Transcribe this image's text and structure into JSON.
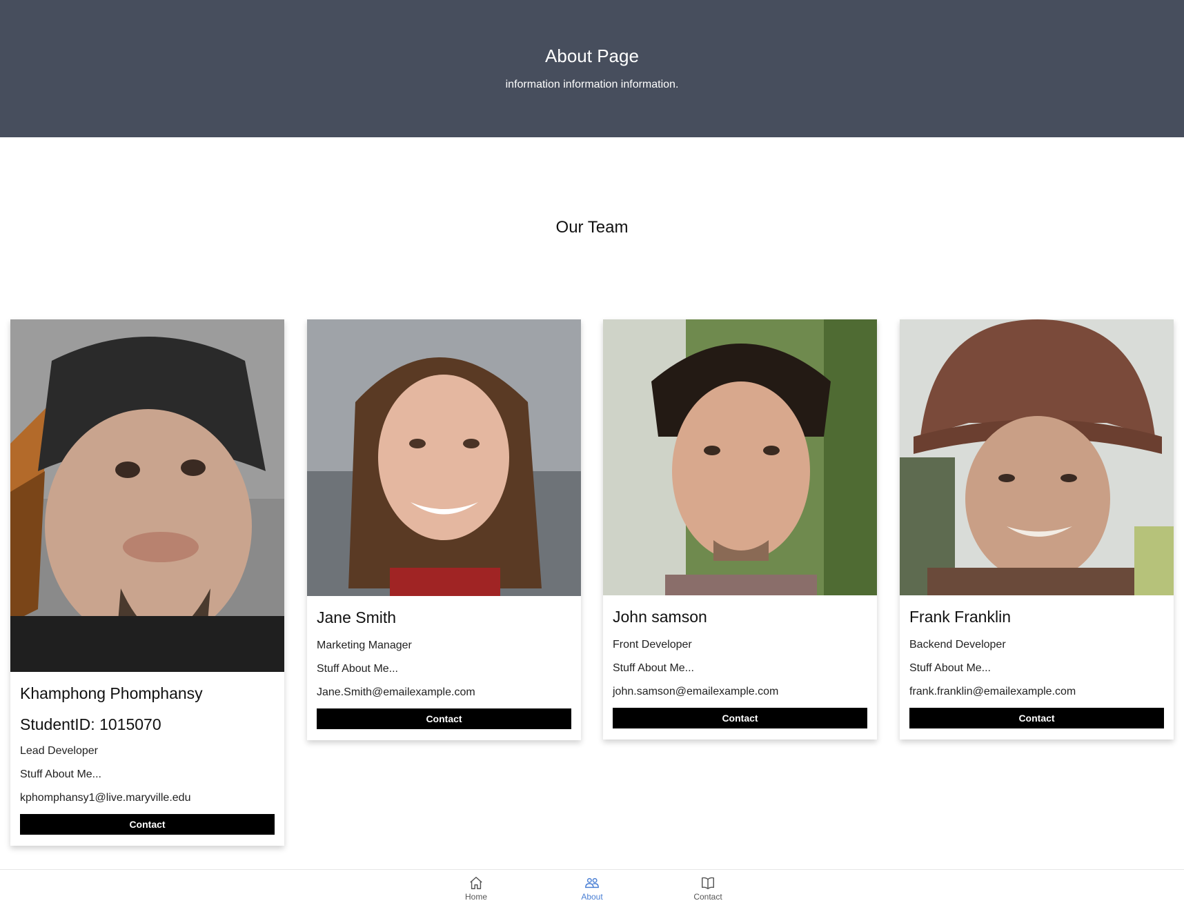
{
  "hero": {
    "title": "About Page",
    "subtitle": "information information information."
  },
  "team": {
    "heading": "Our Team",
    "members": [
      {
        "name": "Khamphong Phomphansy",
        "student_id": "StudentID: 1015070",
        "role": "Lead Developer",
        "about": "Stuff About Me...",
        "email": "kphomphansy1@live.maryville.edu",
        "button": "Contact"
      },
      {
        "name": "Jane Smith",
        "role": "Marketing Manager",
        "about": "Stuff About Me...",
        "email": "Jane.Smith@emailexample.com",
        "button": "Contact"
      },
      {
        "name": "John samson",
        "role": "Front Developer",
        "about": "Stuff About Me...",
        "email": "john.samson@emailexample.com",
        "button": "Contact"
      },
      {
        "name": "Frank Franklin",
        "role": "Backend Developer",
        "about": "Stuff About Me...",
        "email": "frank.franklin@emailexample.com",
        "button": "Contact"
      }
    ]
  },
  "nav": {
    "items": [
      {
        "label": "Home",
        "icon": "home-icon",
        "active": false
      },
      {
        "label": "About",
        "icon": "people-icon",
        "active": true
      },
      {
        "label": "Contact",
        "icon": "book-icon",
        "active": false
      }
    ]
  },
  "colors": {
    "hero_bg": "#474e5d",
    "button_bg": "#000000",
    "nav_active": "#4a7fd4"
  }
}
